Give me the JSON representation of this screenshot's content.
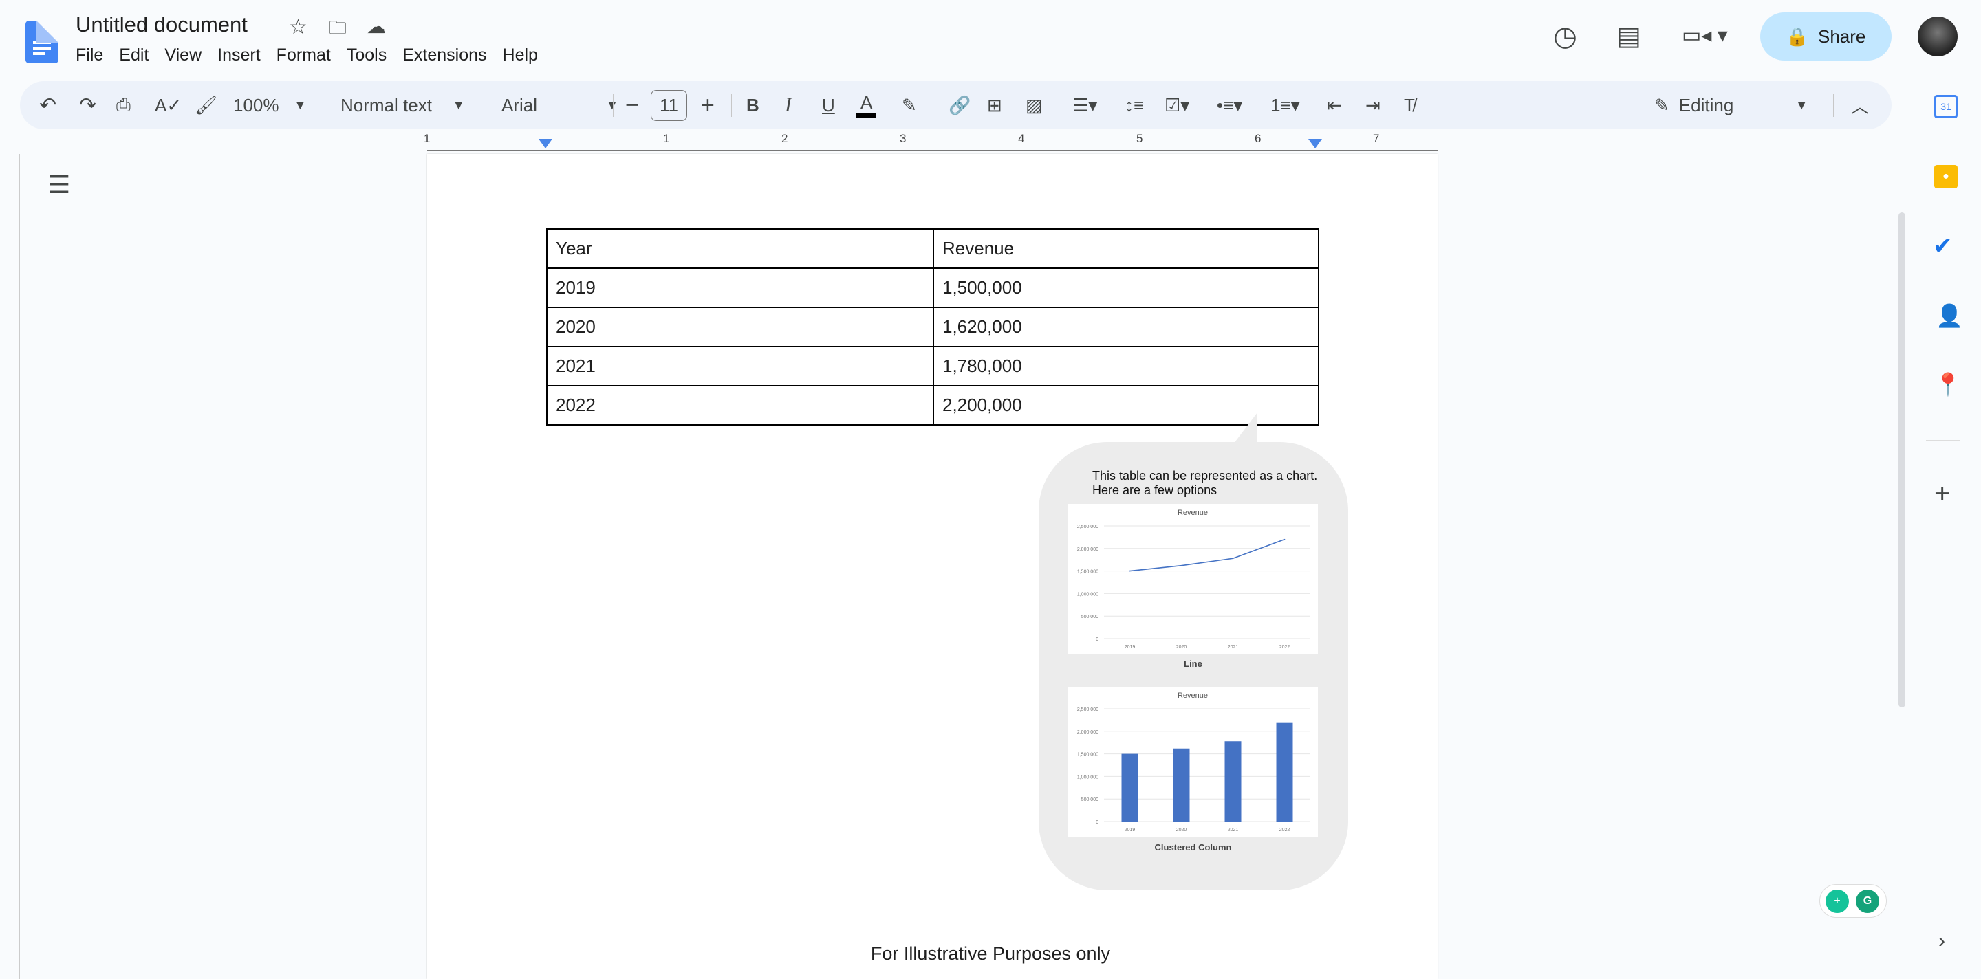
{
  "app": {
    "title": "Untitled document",
    "menu": [
      "File",
      "Edit",
      "View",
      "Insert",
      "Format",
      "Tools",
      "Extensions",
      "Help"
    ]
  },
  "header": {
    "share_label": "Share",
    "icons": [
      "history-icon",
      "comment-icon",
      "meet-icon",
      "avatar"
    ]
  },
  "toolbar": {
    "zoom": "100%",
    "style": "Normal text",
    "font": "Arial",
    "font_size": "11",
    "mode": "Editing"
  },
  "ruler": {
    "labels": [
      "1",
      "1",
      "2",
      "3",
      "4",
      "5",
      "6",
      "7"
    ]
  },
  "table": {
    "headers": [
      "Year",
      "Revenue"
    ],
    "rows": [
      [
        "2019",
        "1,500,000"
      ],
      [
        "2020",
        "1,620,000"
      ],
      [
        "2021",
        "1,780,000"
      ],
      [
        "2022",
        "2,200,000"
      ]
    ]
  },
  "bubble": {
    "text": "This table can be represented as a chart. Here are a few options",
    "line_caption": "Line",
    "bar_caption": "Clustered Column"
  },
  "chart_data": [
    {
      "type": "line",
      "title": "Revenue",
      "categories": [
        "2019",
        "2020",
        "2021",
        "2022"
      ],
      "values": [
        1500000,
        1620000,
        1780000,
        2200000
      ],
      "yticks": [
        "0",
        "500,000",
        "1,000,000",
        "1,500,000",
        "2,000,000",
        "2,500,000"
      ],
      "ylim": [
        0,
        2500000
      ],
      "grid": true,
      "color": "#4472c4"
    },
    {
      "type": "bar",
      "title": "Revenue",
      "categories": [
        "2019",
        "2020",
        "2021",
        "2022"
      ],
      "values": [
        1500000,
        1620000,
        1780000,
        2200000
      ],
      "yticks": [
        "0",
        "500,000",
        "1,000,000",
        "1,500,000",
        "2,000,000",
        "2,500,000"
      ],
      "ylim": [
        0,
        2500000
      ],
      "grid": true,
      "color": "#4472c4"
    }
  ],
  "footer": "For Illustrative Purposes only",
  "sidebar": {
    "icons": [
      "calendar-icon",
      "keep-icon",
      "tasks-icon",
      "contacts-icon",
      "maps-icon",
      "add-icon"
    ]
  }
}
